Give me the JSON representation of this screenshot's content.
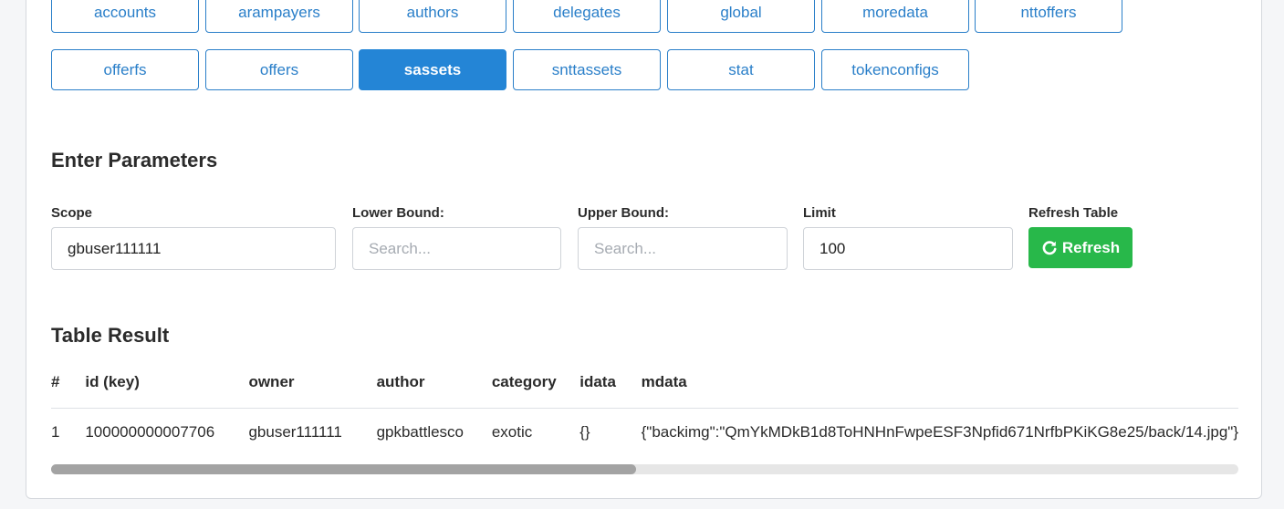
{
  "table_buttons": [
    {
      "label": "accounts",
      "active": false
    },
    {
      "label": "arampayers",
      "active": false
    },
    {
      "label": "authors",
      "active": false
    },
    {
      "label": "delegates",
      "active": false
    },
    {
      "label": "global",
      "active": false
    },
    {
      "label": "moredata",
      "active": false
    },
    {
      "label": "nttoffers",
      "active": false
    },
    {
      "label": "offerfs",
      "active": false
    },
    {
      "label": "offers",
      "active": false
    },
    {
      "label": "sassets",
      "active": true
    },
    {
      "label": "snttassets",
      "active": false
    },
    {
      "label": "stat",
      "active": false
    },
    {
      "label": "tokenconfigs",
      "active": false
    }
  ],
  "params": {
    "title": "Enter Parameters",
    "scope_label": "Scope",
    "scope_value": "gbuser111111",
    "lower_label": "Lower Bound:",
    "lower_placeholder": "Search...",
    "upper_label": "Upper Bound:",
    "upper_placeholder": "Search...",
    "limit_label": "Limit",
    "limit_value": "100",
    "refresh_label": "Refresh Table",
    "refresh_button": "Refresh"
  },
  "result": {
    "title": "Table Result",
    "headers": [
      "#",
      "id (key)",
      "owner",
      "author",
      "category",
      "idata",
      "mdata"
    ],
    "rows": [
      [
        "1",
        "100000000007706",
        "gbuser111111",
        "gpkbattlesco",
        "exotic",
        "{}",
        "{\"backimg\":\"QmYkMDkB1d8ToHNHnFwpeESF3Npfid671NrfbPKiKG8e25/back/14.jpg\"}"
      ]
    ]
  },
  "colors": {
    "accent": "#2485d6",
    "success": "#28b84a"
  },
  "scrollbar": {
    "horizontal_position": 0.0
  }
}
